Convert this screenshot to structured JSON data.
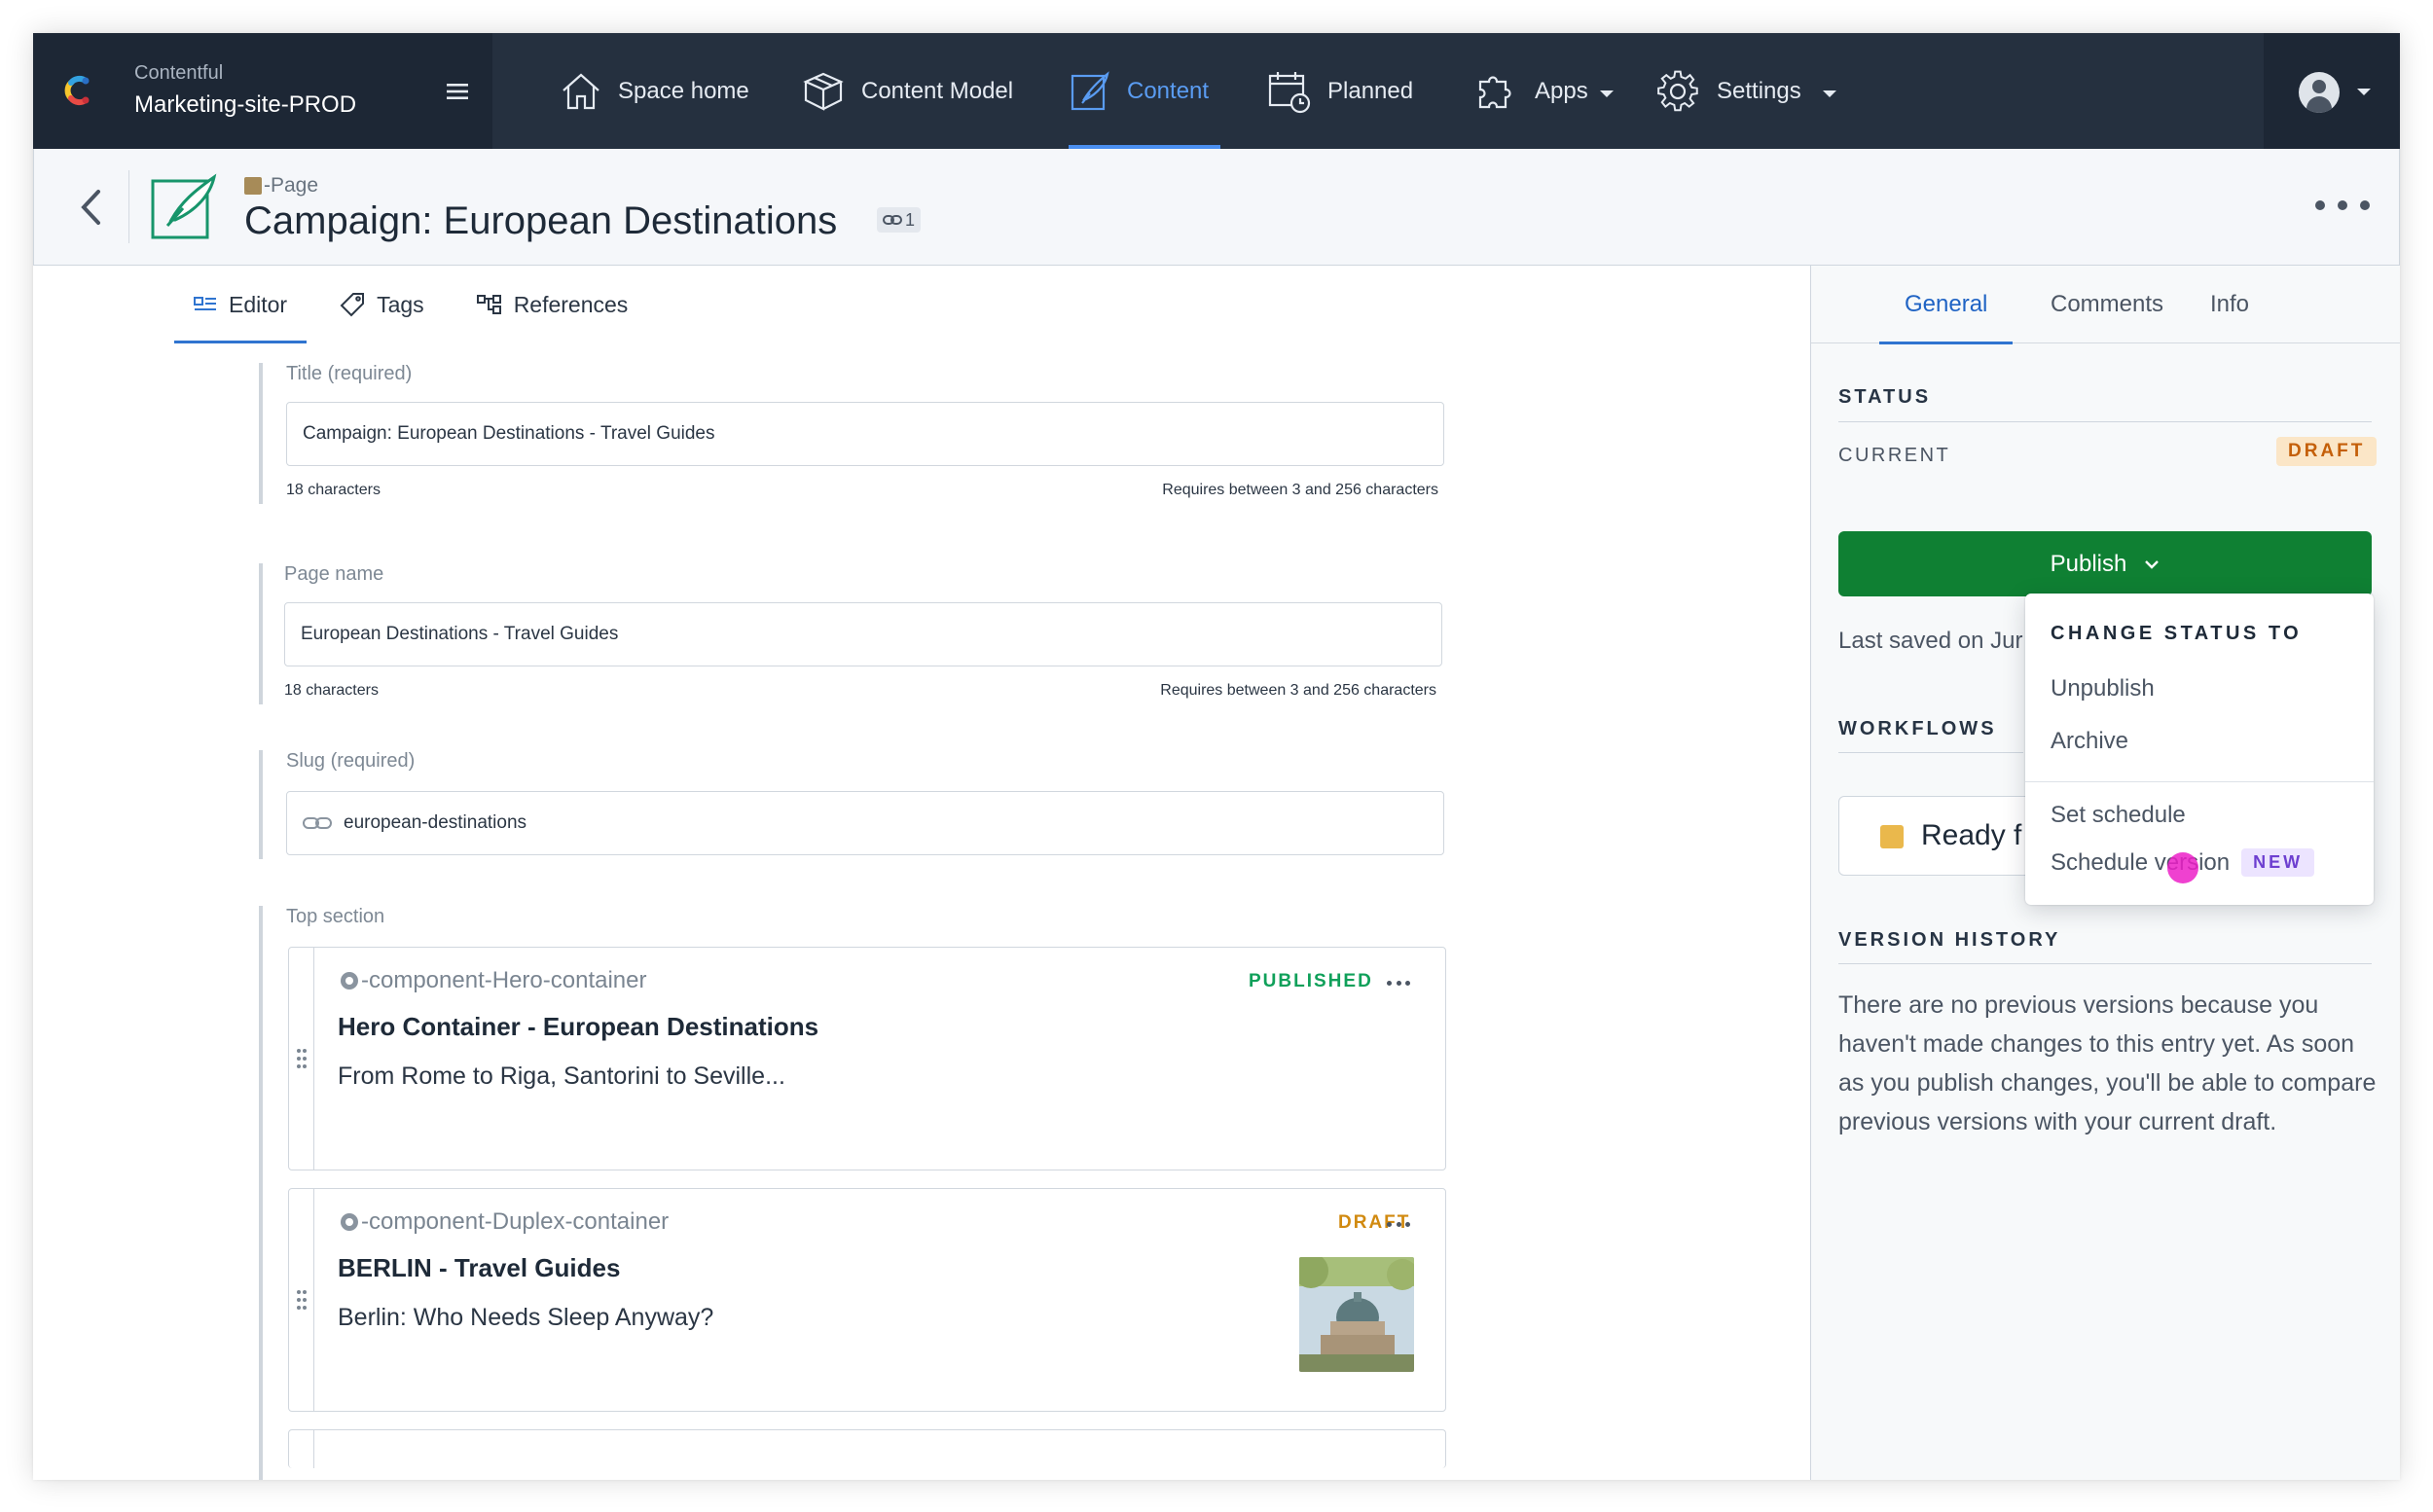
{
  "brand": {
    "accent": "#2f74d0",
    "publish_green": "#0f8033",
    "draft_orange": "#c45f09",
    "published_green": "#10a05a"
  },
  "topnav": {
    "space_org": "Contentful",
    "space_name": "Marketing-site-PROD",
    "items": [
      {
        "label": "Space home",
        "icon": "home-icon"
      },
      {
        "label": "Content Model",
        "icon": "cube-icon"
      },
      {
        "label": "Content",
        "icon": "edit-icon",
        "active": true
      },
      {
        "label": "Planned",
        "icon": "calendar-icon"
      },
      {
        "label": "Apps",
        "icon": "puzzle-icon"
      },
      {
        "label": "Settings",
        "icon": "gear-icon"
      }
    ]
  },
  "entry": {
    "content_type": "-Page",
    "title": "Campaign: European Destinations",
    "ref_count": "1"
  },
  "editor": {
    "tabs": [
      "Editor",
      "Tags",
      "References"
    ],
    "fields": {
      "title": {
        "label": "Title (required)",
        "value": "Campaign: European Destinations - Travel Guides",
        "count": "18 characters",
        "hint": "Requires between 3 and 256 characters"
      },
      "page_name": {
        "label": "Page name",
        "value": "European Destinations - Travel Guides",
        "count": "18 characters",
        "hint": "Requires between 3 and 256 characters"
      },
      "slug": {
        "label": "Slug  (required)",
        "value": "european-destinations"
      },
      "top_section": {
        "label": "Top section"
      }
    },
    "cards": [
      {
        "content_type": "-component-Hero-container",
        "status": "PUBLISHED",
        "title": "Hero Container - European Destinations",
        "description": "From Rome to Riga, Santorini to Seville..."
      },
      {
        "content_type": "-component-Duplex-container",
        "status": "DRAFT",
        "title": "BERLIN - Travel Guides",
        "description": "Berlin: Who Needs Sleep Anyway?"
      }
    ]
  },
  "sidebar": {
    "tabs": [
      "General",
      "Comments",
      "Info"
    ],
    "status_heading": "STATUS",
    "current_label": "CURRENT",
    "current_status": "DRAFT",
    "publish_label": "Publish",
    "last_saved": "Last saved on Jur",
    "workflows_heading": "WORKFLOWS",
    "workflow_state": "Ready f",
    "version_heading": "VERSION HISTORY",
    "version_text": "There are no previous versions because you haven't made changes to this entry yet. As soon as you publish changes, you'll be able to compare previous versions with your current draft."
  },
  "dropdown": {
    "heading": "CHANGE STATUS TO",
    "items": [
      "Unpublish",
      "Archive",
      "Set schedule",
      "Schedule version"
    ],
    "new_badge": "NEW"
  }
}
